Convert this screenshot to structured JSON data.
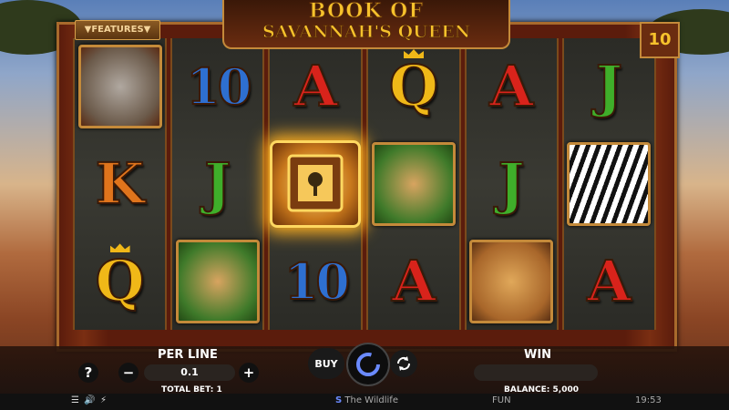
{
  "game": {
    "title_line1": "BOOK OF",
    "title_line2": "SAVANNAH'S QUEEN",
    "features_label": "▼FEATURES▼",
    "lines_count": "10"
  },
  "reels": [
    [
      {
        "kind": "pic",
        "name": "rhino",
        "cls": "rhino"
      },
      {
        "kind": "letter",
        "text": "K",
        "color": "c-orange"
      },
      {
        "kind": "letter",
        "text": "Q",
        "color": "c-gold",
        "crown": true
      }
    ],
    [
      {
        "kind": "letter",
        "text": "10",
        "color": "c-blue",
        "ten": true
      },
      {
        "kind": "letter",
        "text": "J",
        "color": "c-green"
      },
      {
        "kind": "pic",
        "name": "giraffe",
        "cls": "giraffe"
      }
    ],
    [
      {
        "kind": "letter",
        "text": "A",
        "color": "c-red"
      },
      {
        "kind": "book",
        "name": "book"
      },
      {
        "kind": "letter",
        "text": "10",
        "color": "c-blue",
        "ten": true
      }
    ],
    [
      {
        "kind": "letter",
        "text": "Q",
        "color": "c-gold",
        "crown": true
      },
      {
        "kind": "pic",
        "name": "giraffe",
        "cls": "giraffe"
      },
      {
        "kind": "letter",
        "text": "A",
        "color": "c-red"
      }
    ],
    [
      {
        "kind": "letter",
        "text": "A",
        "color": "c-red"
      },
      {
        "kind": "letter",
        "text": "J",
        "color": "c-green"
      },
      {
        "kind": "pic",
        "name": "lioness",
        "cls": "lion"
      }
    ],
    [
      {
        "kind": "letter",
        "text": "J",
        "color": "c-green"
      },
      {
        "kind": "pic",
        "name": "zebra",
        "cls": "zebra"
      },
      {
        "kind": "letter",
        "text": "A",
        "color": "c-red"
      }
    ]
  ],
  "controls": {
    "help": "?",
    "per_line_label": "PER LINE",
    "per_line_value": "0.1",
    "minus": "−",
    "plus": "+",
    "total_bet": "TOTAL BET: 1",
    "buy": "BUY",
    "win_label": "WIN",
    "balance": "BALANCE: 5,000"
  },
  "footer": {
    "brand": "The Wildlife",
    "mode": "FUN",
    "clock": "19:53"
  }
}
